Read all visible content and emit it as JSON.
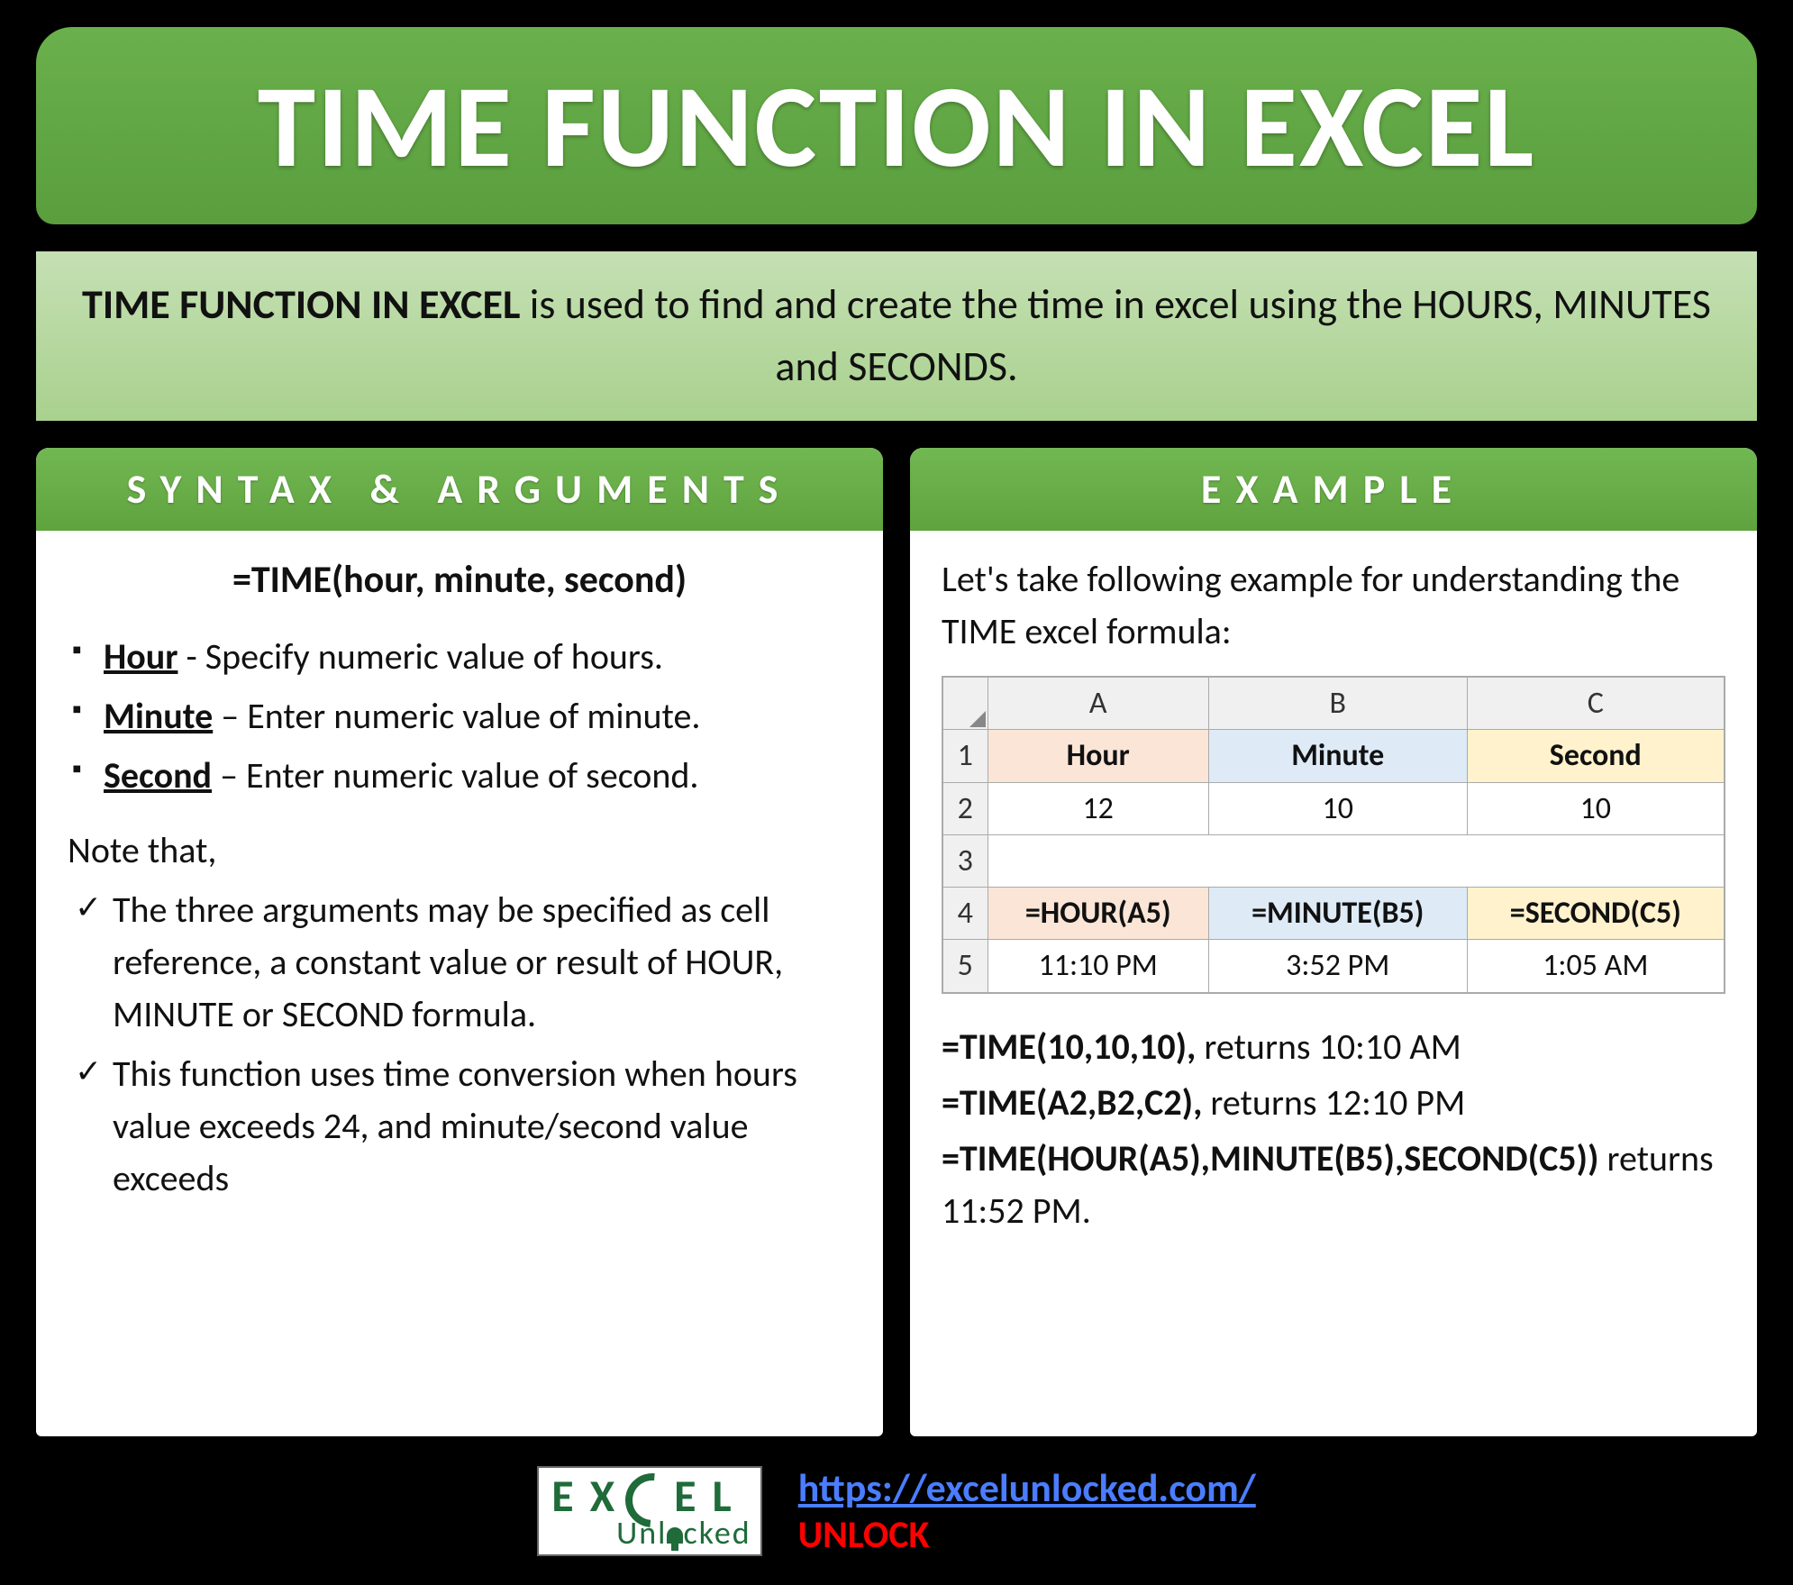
{
  "title": "TIME FUNCTION IN EXCEL",
  "description": {
    "bold": "TIME FUNCTION IN EXCEL",
    "rest": " is used to find and create the time in excel using the HOURS, MINUTES and SECONDS."
  },
  "left": {
    "header": "SYNTAX & ARGUMENTS",
    "syntax": "=TIME(hour, minute, second)",
    "args": [
      {
        "name": "Hour",
        "sep": " - ",
        "desc": "Specify numeric value of hours."
      },
      {
        "name": "Minute",
        "sep": " – ",
        "desc": "Enter numeric value of minute."
      },
      {
        "name": "Second",
        "sep": " – ",
        "desc": "Enter numeric value of second."
      }
    ],
    "note_label": "Note that,",
    "notes": [
      "The three arguments may be specified as cell reference, a constant value or result of HOUR, MINUTE or SECOND formula.",
      "This function uses time conversion when hours value exceeds 24, and minute/second value exceeds"
    ]
  },
  "right": {
    "header": "EXAMPLE",
    "intro": "Let's take following example for understanding the TIME excel formula:",
    "table": {
      "cols": [
        "A",
        "B",
        "C"
      ],
      "r1": {
        "n": "1",
        "A": "Hour",
        "B": "Minute",
        "C": "Second"
      },
      "r2": {
        "n": "2",
        "A": "12",
        "B": "10",
        "C": "10"
      },
      "r3": {
        "n": "3"
      },
      "r4": {
        "n": "4",
        "A": "=HOUR(A5)",
        "B": "=MINUTE(B5)",
        "C": "=SECOND(C5)"
      },
      "r5": {
        "n": "5",
        "A": "11:10 PM",
        "B": "3:52 PM",
        "C": "1:05 AM"
      }
    },
    "results": [
      {
        "formula": "=TIME(10,10,10),",
        "text": " returns 10:10 AM"
      },
      {
        "formula": "=TIME(A2,B2,C2),",
        "text": " returns 12:10 PM"
      },
      {
        "formula": "=TIME(HOUR(A5),MINUTE(B5),SECOND(C5))",
        "text": " returns 11:52 PM."
      }
    ]
  },
  "footer": {
    "logo_top1": "EX",
    "logo_top2": "EL",
    "logo_bottom1": "Unl",
    "logo_bottom2": "cked",
    "url": "https://excelunlocked.com/",
    "unlock": "UNLOCK"
  }
}
